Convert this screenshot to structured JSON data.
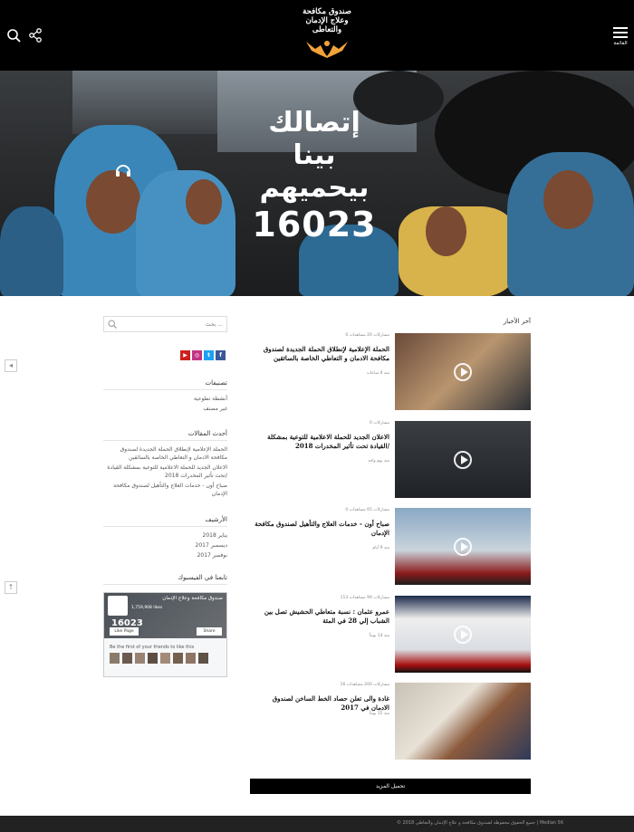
{
  "header": {
    "logo_line1": "صندوق مكافحة",
    "logo_line2": "وعلاج الإدمان",
    "logo_line3": "والتعاطى",
    "menu_label": "القائمة"
  },
  "hero": {
    "line1": "إتصالك",
    "line2": "بينا",
    "line3": "بيحميهم",
    "number": "16023"
  },
  "sidebar": {
    "search_placeholder": "بحث ...",
    "social": [
      "f",
      "t",
      "◎",
      "▶"
    ],
    "categories_title": "تصنيفات",
    "categories": [
      "أنشطة تطوعية",
      "غير مصنف"
    ],
    "recent_title": "أحدث المقالات",
    "recent": [
      "الحملة الإعلامية لإنطلاق الحملة الجديدة لصندوق مكافحة الادمان و التعاطي الخاصة بالسائقين",
      "الاعلان الجديد للحملة الاعلامية للتوعية بمشكلة القيادة تحت تأثير المخدرات 2018/",
      "صباح أون - خدمات العلاج والتأهيل لصندوق مكافحة الإدمان"
    ],
    "archive_title": "الأرشيف",
    "archive": [
      "يناير 2018",
      "ديسمبر 2017",
      "نوفمبر 2017"
    ],
    "fb_title": "تابعنا في الفيسبوك",
    "fb": {
      "page_name": "صندوق مكافحة وعلاج الإدمان",
      "likes": "1,759,908 likes",
      "number": "16023",
      "like_btn": "Like Page",
      "share_btn": "Share",
      "friends": "Be the first of your friends to like this"
    }
  },
  "news": {
    "heading": "آخر الأخبار",
    "items": [
      {
        "meta": "0 مشاركات   20 مشاهدات",
        "title": "الحملة الإعلامية لإنطلاق الحملة الجديدة لصندوق مكافحة الادمان و التعاطي الخاصة بالسائقين",
        "date": "منذ 4 ساعات"
      },
      {
        "meta": "0 مشاركات",
        "title": "الاعلان الجديد للحملة الاعلامية للتوعية بمشكلة القيادة تحت تأثير المخدرات 2018/",
        "date": "منذ يوم واحد"
      },
      {
        "meta": "0 مشاركات   65 مشاهدات",
        "title": "صباح أون - خدمات العلاج والتأهيل لصندوق مكافحة الإدمان",
        "date": "منذ 9 أيام"
      },
      {
        "meta": "113 مشاركات   99 مشاهدات",
        "title": "عمرو عثمان : نسبة متعاطي الحشيش تصل بين الشباب إلي 28 في المئة",
        "date": "منذ 14 يوماً"
      },
      {
        "meta": "16 مشاركات   200 مشاهدات",
        "title": "غادة والى تعلن حصاد الخط الساخن لصندوق الادمان في 2017",
        "date": "منذ 15 يوماً"
      }
    ],
    "more": "تحميل المزيد"
  },
  "footer": {
    "copyright": "© 2018 جميع الحقوق محفوظة لصندوق مكافحة و علاج الإدمان والتعاطي | Medlan 56"
  },
  "colors": {
    "brand_orange": "#f2a23a",
    "black": "#000000",
    "facebook": "#3b5998",
    "twitter": "#1da1f2",
    "instagram": "#c13584",
    "youtube": "#cd201f"
  }
}
